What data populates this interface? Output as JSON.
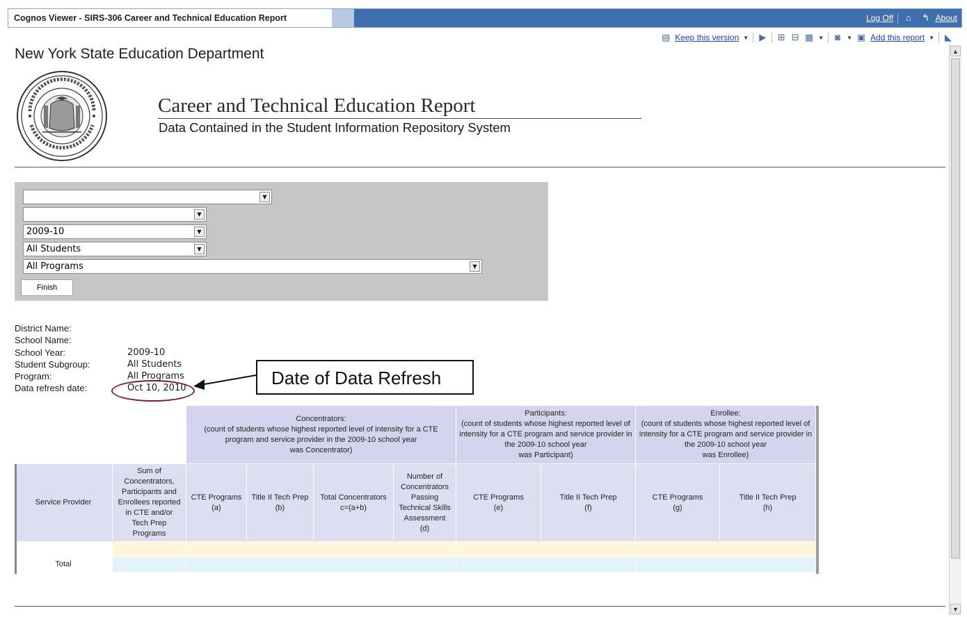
{
  "window": {
    "title": "Cognos Viewer - SIRS-306 Career and Technical Education Report",
    "links": {
      "logoff": "Log Off",
      "about": "About"
    }
  },
  "toolbar": {
    "keep_version": "Keep this version",
    "add_report": "Add this report"
  },
  "header": {
    "org": "New York State Education Department",
    "title": "Career and Technical Education Report",
    "subtitle": "Data Contained in the Student Information Repository System"
  },
  "prompts": {
    "district": "",
    "school": "",
    "year": "2009-10",
    "subgroup": "All Students",
    "program": "All Programs",
    "finish": "Finish"
  },
  "info": {
    "labels": {
      "district": "District Name:",
      "school": "School Name:",
      "year": "School Year:",
      "subgroup": "Student Subgroup:",
      "program": "Program:",
      "refresh": "Data refresh date:"
    },
    "values": {
      "district": "",
      "school": "",
      "year": "2009-10",
      "subgroup": "All Students",
      "program": "All Programs",
      "refresh": "Oct 10, 2010"
    }
  },
  "callout": "Date of Data Refresh",
  "table": {
    "groups": {
      "concentrators": "Concentrators:\n(count of students whose highest reported level of intensity for a CTE program and service provider in the 2009-10 school year\nwas Concentrator)",
      "participants": "Participants:\n(count of students whose highest reported level of intensity for a CTE program and service provider in the 2009-10 school year\nwas Participant)",
      "enrollee": "Enrollee:\n(count of students whose highest reported level of intensity for a CTE program and service provider in the 2009-10 school year\nwas Enrollee)"
    },
    "columns": {
      "service_provider": "Service Provider",
      "sum": "Sum of Concentrators, Participants and Enrollees reported in CTE and/or Tech Prep Programs",
      "conc_cte": "CTE Programs\n(a)",
      "conc_tech": "Title II Tech Prep\n(b)",
      "conc_total": "Total Concentrators\nc=(a+b)",
      "conc_passing": "Number of Concentrators Passing Technical Skills Assessment\n(d)",
      "part_cte": "CTE Programs\n(e)",
      "part_tech": "Title II Tech Prep\n(f)",
      "enr_cte": "CTE Programs\n(g)",
      "enr_tech": "Title II Tech Prep\n(h)"
    },
    "total_label": "Total"
  }
}
